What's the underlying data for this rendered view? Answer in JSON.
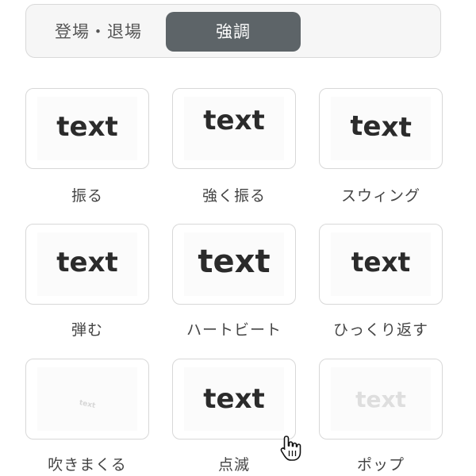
{
  "tabs": {
    "enter_exit": "登場・退場",
    "emphasis": "強調"
  },
  "animations": [
    {
      "preview": "text",
      "label": "振る"
    },
    {
      "preview": "text",
      "label": "強く振る"
    },
    {
      "preview": "text",
      "label": "スウィング"
    },
    {
      "preview": "text",
      "label": "弾む"
    },
    {
      "preview": "text",
      "label": "ハートビート"
    },
    {
      "preview": "text",
      "label": "ひっくり返す"
    },
    {
      "preview": "text",
      "label": "吹きまくる"
    },
    {
      "preview": "text",
      "label": "点滅"
    },
    {
      "preview": "text",
      "label": "ポップ"
    }
  ],
  "colors": {
    "active_tab_bg": "#5d6468",
    "card_border": "#d8d8d8"
  }
}
